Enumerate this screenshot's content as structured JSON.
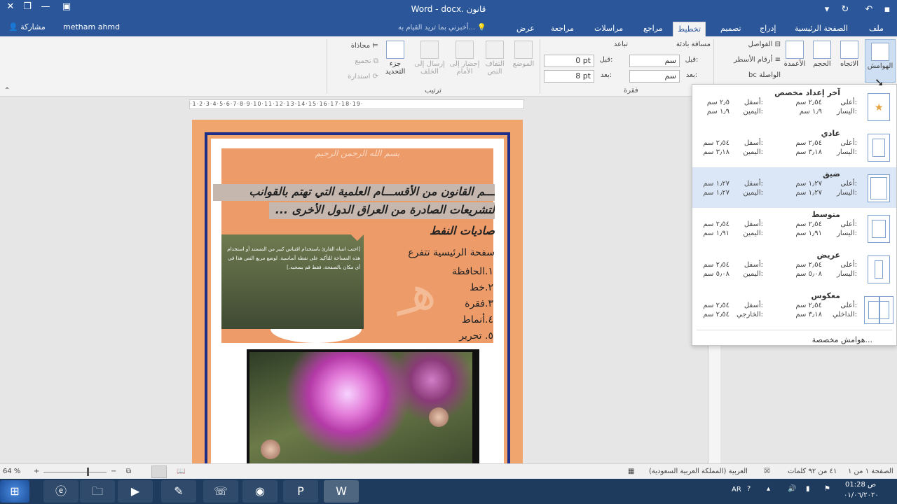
{
  "window": {
    "title": "Word - docx. قانون",
    "user": "metham ahmd",
    "share": "مشاركة"
  },
  "tabs": [
    "ملف",
    "الصفحة الرئيسية",
    "إدراج",
    "تصميم",
    "تخطيط",
    "مراجع",
    "مراسلات",
    "مراجعة",
    "عرض"
  ],
  "active_tab": "تخطيط",
  "tell_me": "أخبرني بما تريد القيام به...",
  "ribbon": {
    "page_setup": {
      "margins": "الهوامش",
      "orientation": "الاتجاه",
      "size": "الحجم",
      "columns": "الأعمدة",
      "breaks": "الفواصل",
      "line_numbers": "أرقام الأسطر",
      "hyphenation": "bc الواصلة"
    },
    "indent": {
      "label": "مسافة بادئة",
      "before_label": "قبل:",
      "before_value": "سم",
      "after_label": "بعد:",
      "after_value": "سم"
    },
    "spacing": {
      "label": "تباعد",
      "before_label": "قبل:",
      "before_value": "0 pt",
      "after_label": "بعد:",
      "after_value": "8 pt"
    },
    "paragraph_group": "فقرة",
    "arrange": {
      "position": "الموضع",
      "wrap": "التفاف النص",
      "forward": "إحضار إلى الأمام",
      "backward": "إرسال إلى الخلف",
      "selection_pane": "جزء التحديد",
      "align": "محاذاة",
      "group": "تجميع",
      "rotate": "استدارة",
      "group_label": "ترتيب"
    }
  },
  "ruler": "·1·2·3·4·5·6·7·8·9·10·11·12·13·14·15·16·17·18·19·",
  "document": {
    "bismillah": "بسم الله الرحمن الرحيم",
    "line1": "ـــم القانون من الأقســـام العلمية التي تهتم بالقوانب",
    "line2": "لتشريعات الصادرة من العراق الدول الأخرى ...",
    "line3": "صاديات النفط",
    "line4": "سفحة الرئيسية تتفرع",
    "list": [
      "١.الحافظة",
      "٢.خط",
      "٣.فقرة",
      "٤.أنماط",
      "٥. تحرير"
    ],
    "textbox": "[اجتب انتباه القارئ باستخدام اقتباس كبير من المستند أو استخدام هذه المساحة للتأكيد على نقطة أساسية. لوضع مربع النص هذا في أي مكان بالصفحة، فقط قم بسحبه.]",
    "watermark": "هـ"
  },
  "margins_gallery": {
    "items": [
      {
        "name": "آخر إعداد مخصص",
        "top": "٢٫٥٤ سم",
        "bottom": "٢٫٥ سم",
        "left": "١٫٩ سم",
        "right": "١٫٩ سم",
        "l1": "أعلى:",
        "l2": "أسفل:",
        "l3": "اليسار:",
        "l4": "اليمين:"
      },
      {
        "name": "عادي",
        "top": "٢٫٥٤ سم",
        "bottom": "٢٫٥٤ سم",
        "left": "٣٫١٨ سم",
        "right": "٣٫١٨ سم",
        "l1": "أعلى:",
        "l2": "أسفل:",
        "l3": "اليسار:",
        "l4": "اليمين:"
      },
      {
        "name": "ضيق",
        "top": "١٫٢٧ سم",
        "bottom": "١٫٢٧ سم",
        "left": "١٫٢٧ سم",
        "right": "١٫٢٧ سم",
        "l1": "أعلى:",
        "l2": "أسفل:",
        "l3": "اليسار:",
        "l4": "اليمين:"
      },
      {
        "name": "متوسط",
        "top": "٢٫٥٤ سم",
        "bottom": "٢٫٥٤ سم",
        "left": "١٫٩١ سم",
        "right": "١٫٩١ سم",
        "l1": "أعلى:",
        "l2": "أسفل:",
        "l3": "اليسار:",
        "l4": "اليمين:"
      },
      {
        "name": "عريض",
        "top": "٢٫٥٤ سم",
        "bottom": "٢٫٥٤ سم",
        "left": "٥٫٠٨ سم",
        "right": "٥٫٠٨ سم",
        "l1": "أعلى:",
        "l2": "أسفل:",
        "l3": "اليسار:",
        "l4": "اليمين:"
      },
      {
        "name": "معكوس",
        "top": "٢٫٥٤ سم",
        "bottom": "٢٫٥٤ سم",
        "left": "٣٫١٨ سم",
        "right": "٢٫٥٤ سم",
        "l1": "أعلى:",
        "l2": "أسفل:",
        "l3": "الداخلي:",
        "l4": "الخارجي:"
      }
    ],
    "custom": "هوامش مخصصة..."
  },
  "status": {
    "page": "الصفحة ١ من ١",
    "words": "٤١ من ٩٢ كلمات",
    "language": "العربية (المملكة العربية السعودية)",
    "zoom": "64 %"
  },
  "taskbar": {
    "lang": "AR",
    "time": "01:28 ص",
    "date": "٠١/٠٦/٢٠٢٠"
  },
  "colors": {
    "accent": "#2b579a",
    "page": "#f0a46e",
    "border": "#1c2e8a"
  }
}
